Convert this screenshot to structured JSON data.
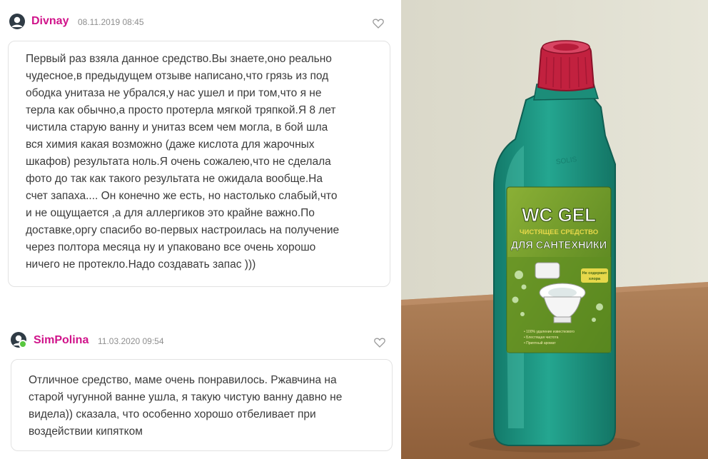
{
  "reviews": [
    {
      "author": "Divnay",
      "date": "08.11.2019 08:45",
      "text": "Первый раз взяла данное средство.Вы знаете,оно реально\nчудесное,в предыдущем отзыве написано,что грязь из под\nободка унитаза не убрался,у нас ушел и при том,что я не\nтерла как обычно,а просто протерла мягкой тряпкой.Я 8 лет\nчистила старую ванну и унитаз всем чем могла, в бой шла\nвся химия какая возможно (даже кислота для жарочных\nшкафов) результата ноль.Я очень сожалею,что не сделала\nфото до так как такого результата не ожидала вообще.На\nсчет запаха.... Он конечно же есть, но настолько слабый,что\nи не ощущается ,а для аллергиков это крайне важно.По\nдоставке,оргу спасибо во-первых настроилась на получение\nчерез полтора месяца ну и упаковано все очень хорошо\nничего не протекло.Надо создавать запас )))"
    },
    {
      "author": "SimPolina",
      "date": "11.03.2020 09:54",
      "text": "Отличное средство, маме очень понравилось. Ржавчина на\nстарой чугунной ванне ушла, я такую чистую ванну давно не\nвидела)) сказала, что особенно хорошо отбеливает при\nвоздействии кипятком"
    }
  ],
  "product_label": {
    "brand": "WC GEL",
    "line1": "ЧИСТЯЩЕЕ СРЕДСТВО",
    "line2": "ДЛЯ САНТЕХНИКИ",
    "badge": "Не содержит хлора",
    "bullets": [
      "100% удаление известкового налёта и ржавчины",
      "Блестящая чистота",
      "Приятный аромат"
    ]
  },
  "colors": {
    "author": "#d0138a",
    "bottle": "#1f9a86",
    "cap": "#c2213f",
    "label_green": "#6e9a26",
    "label_yellow": "#e6d84a"
  }
}
